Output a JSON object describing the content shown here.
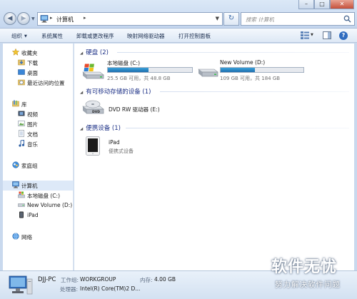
{
  "titlebar": {
    "address_crumb": "计算机",
    "search_placeholder": "搜索 计算机",
    "window_buttons": {
      "minimize": "–",
      "maximize": "□",
      "close": "✕"
    }
  },
  "toolbar": {
    "items": [
      "组织",
      "系统属性",
      "卸载或更改程序",
      "映射网络驱动器",
      "打开控制面板"
    ]
  },
  "navpane": {
    "favorites": "收藏夹",
    "downloads": "下载",
    "desktop": "桌面",
    "recent": "最近访问的位置",
    "libraries": "库",
    "videos": "视频",
    "pictures": "图片",
    "documents": "文档",
    "music": "音乐",
    "homegroup": "家庭组",
    "computer": "计算机",
    "local_disk_c": "本地磁盘 (C:)",
    "new_volume_d": "New Volume (D:)",
    "ipad": "iPad",
    "network": "网络"
  },
  "main": {
    "hdd_group": "硬盘 (2)",
    "drive_c": {
      "name": "本地磁盘 (C:)",
      "space": "25.5 GB 可用，共 48.8 GB",
      "used_fraction": 0.48
    },
    "drive_d": {
      "name": "New Volume (D:)",
      "space": "109 GB 可用，共 184 GB",
      "used_fraction": 0.41
    },
    "removable_group": "有可移动存储的设备 (1)",
    "dvd": {
      "name": "DVD RW 驱动器 (E:)",
      "logo": "DVD"
    },
    "portable_group": "便携设备 (1)",
    "ipad": {
      "name": "iPad",
      "sub": "便携式设备"
    }
  },
  "details": {
    "pc_name": "DJJ-PC",
    "workgroup_label": "工作组:",
    "workgroup_value": "WORKGROUP",
    "memory_label": "内存:",
    "memory_value": "4.00 GB",
    "processor_label": "处理器:",
    "processor_value": "Intel(R) Core(TM)2 D..."
  },
  "watermark": {
    "title": "软件无忧",
    "subtitle": "努力解决软件问题"
  }
}
